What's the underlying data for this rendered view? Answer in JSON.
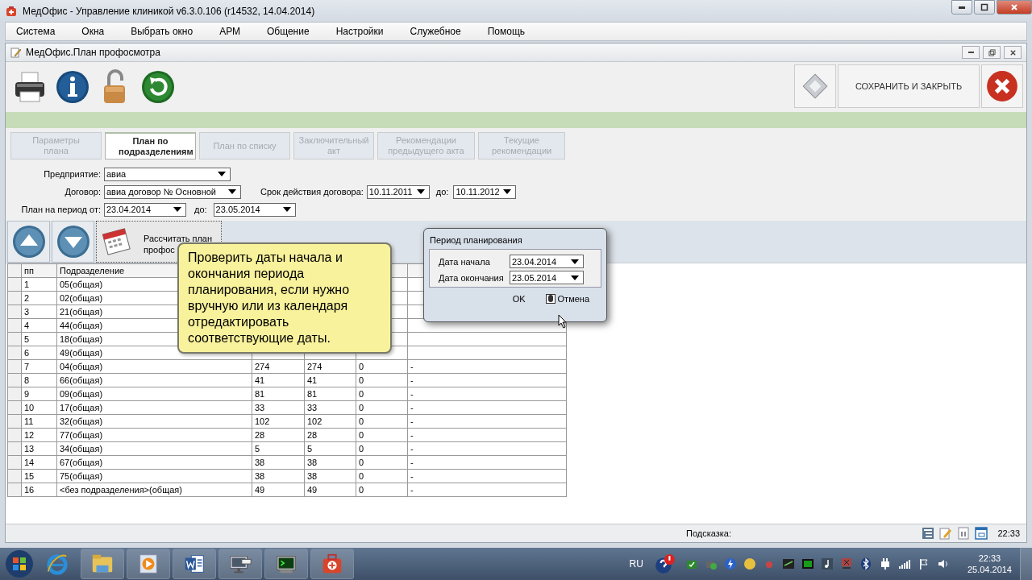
{
  "app_window": {
    "title": "МедОфис - Управление клиникой v6.3.0.106 (r14532, 14.04.2014)",
    "menu": [
      "Система",
      "Окна",
      "Выбрать окно",
      "АРМ",
      "Общение",
      "Настройки",
      "Служебное",
      "Помощь"
    ]
  },
  "form_window": {
    "title": "МедОфис.План профосмотра"
  },
  "toolbar": {
    "save_close": "СОХРАНИТЬ И ЗАКРЫТЬ"
  },
  "tabs": [
    {
      "label": "Параметры плана",
      "selected": false,
      "disabled": true
    },
    {
      "label": "План по подразделениям",
      "selected": true,
      "disabled": false
    },
    {
      "label": "План по списку",
      "selected": false,
      "disabled": true
    },
    {
      "label": "Заключительный акт",
      "selected": false,
      "disabled": true
    },
    {
      "label": "Рекомендации предыдущего акта",
      "selected": false,
      "disabled": true
    },
    {
      "label": "Текущие рекомендации",
      "selected": false,
      "disabled": true
    }
  ],
  "filters": {
    "enterprise_label": "Предприятие:",
    "enterprise": "авиа",
    "contract_label": "Договор:",
    "contract": "авиа договор № Основной",
    "validity_label": "Срок действия договора:",
    "validity_from": "10.11.2011",
    "validity_to_label": "до:",
    "validity_to": "10.11.2012",
    "period_label": "План на период от:",
    "period_from": "23.04.2014",
    "period_to_label": "до:",
    "period_to": "23.05.2014"
  },
  "calc_button": {
    "line_1": "Рассчитать план",
    "line_2": "профос"
  },
  "table": {
    "columns": [
      "пп",
      "Подразделение"
    ],
    "rows": [
      {
        "cells": [
          "1",
          "05(общая)"
        ]
      },
      {
        "cells": [
          "2",
          "02(общая)"
        ]
      },
      {
        "cells": [
          "3",
          "21(общая)"
        ]
      },
      {
        "cells": [
          "4",
          "44(общая)"
        ]
      },
      {
        "cells": [
          "5",
          "18(общая)"
        ]
      },
      {
        "cells": [
          "6",
          "49(общая)"
        ]
      },
      {
        "cells": [
          "7",
          "04(общая)",
          "274",
          "274",
          "0",
          "-"
        ]
      },
      {
        "cells": [
          "8",
          "66(общая)",
          "41",
          "41",
          "0",
          "-"
        ]
      },
      {
        "cells": [
          "9",
          "09(общая)",
          "81",
          "81",
          "0",
          "-"
        ]
      },
      {
        "cells": [
          "10",
          "17(общая)",
          "33",
          "33",
          "0",
          "-"
        ]
      },
      {
        "cells": [
          "11",
          "32(общая)",
          "102",
          "102",
          "0",
          "-"
        ]
      },
      {
        "cells": [
          "12",
          "77(общая)",
          "28",
          "28",
          "0",
          "-"
        ]
      },
      {
        "cells": [
          "13",
          "34(общая)",
          "5",
          "5",
          "0",
          "-"
        ]
      },
      {
        "cells": [
          "14",
          "67(общая)",
          "38",
          "38",
          "0",
          "-"
        ]
      },
      {
        "cells": [
          "15",
          "75(общая)",
          "38",
          "38",
          "0",
          "-"
        ]
      },
      {
        "cells": [
          "16",
          "<без подразделения>(общая)",
          "49",
          "49",
          "0",
          "-"
        ]
      }
    ]
  },
  "hint_bubble": "Проверить даты начала и окончания периода планирования, если нужно вручную или из календаря отредактировать соответствующие даты.",
  "dialog": {
    "title": "Период планирования",
    "start_label": "Дата начала",
    "start": "23.04.2014",
    "end_label": "Дата окончания",
    "end": "23.05.2014",
    "ok": "OK",
    "cancel": "Отмена"
  },
  "status_bar": {
    "hint_label": "Подсказка:",
    "time": "22:33"
  },
  "taskbar": {
    "language": "RU",
    "time": "22:33",
    "date": "25.04.2014"
  }
}
